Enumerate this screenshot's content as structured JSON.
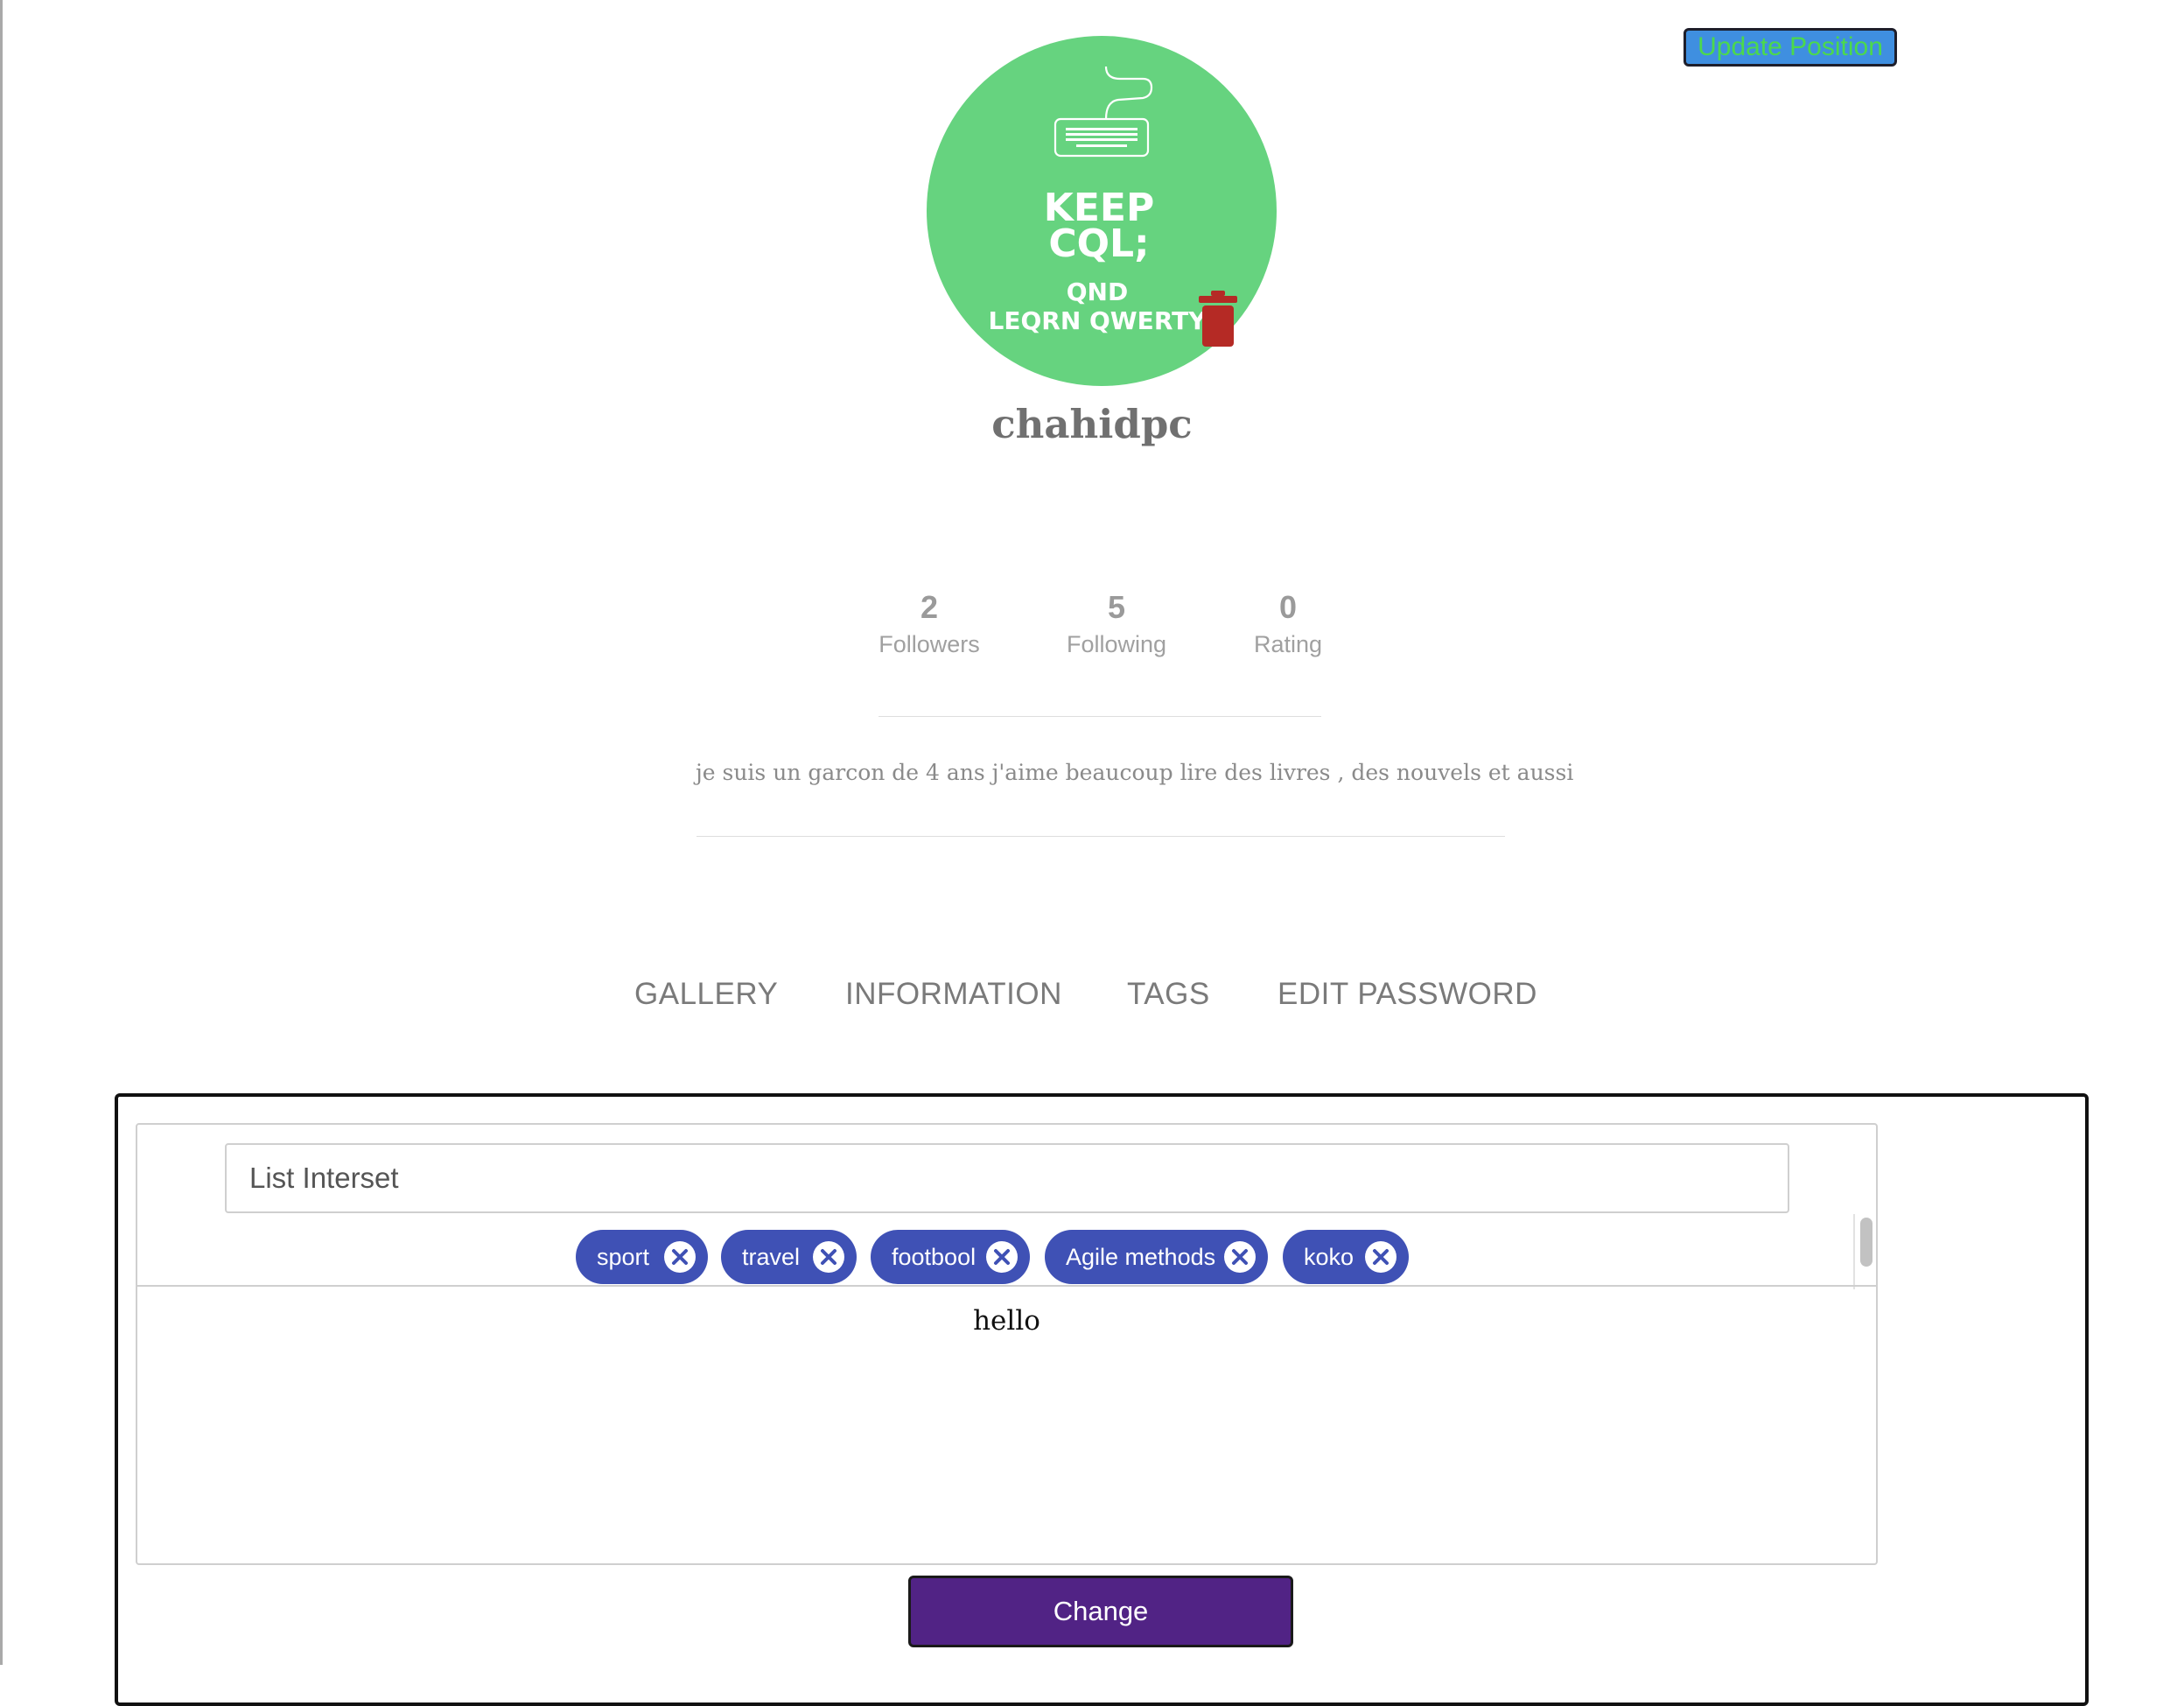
{
  "header": {
    "update_position_label": "Update Position"
  },
  "profile": {
    "avatar_lines": [
      "KEEP",
      "CQL;",
      "QND",
      "LEQRN QWERTY"
    ],
    "avatar_color": "#66d37f",
    "delete_icon": "trash-icon",
    "delete_color": "#b52a25",
    "username": "chahidpc",
    "stats": [
      {
        "value": "2",
        "label": "Followers"
      },
      {
        "value": "5",
        "label": "Following"
      },
      {
        "value": "0",
        "label": "Rating"
      }
    ],
    "bio": "je suis un garcon de 4 ans j'aime beaucoup lire des livres , des nouvels et aussi"
  },
  "tabs": [
    {
      "label": "GALLERY"
    },
    {
      "label": "INFORMATION"
    },
    {
      "label": "TAGS"
    },
    {
      "label": "EDIT PASSWORD"
    }
  ],
  "tags_panel": {
    "input_placeholder": "List Interset",
    "chip_color": "#3f51b5",
    "chips": [
      {
        "label": "sport"
      },
      {
        "label": "travel"
      },
      {
        "label": "footbool"
      },
      {
        "label": "Agile methods"
      },
      {
        "label": "koko"
      }
    ],
    "content_text": "hello",
    "change_label": "Change",
    "change_color": "#512385"
  }
}
